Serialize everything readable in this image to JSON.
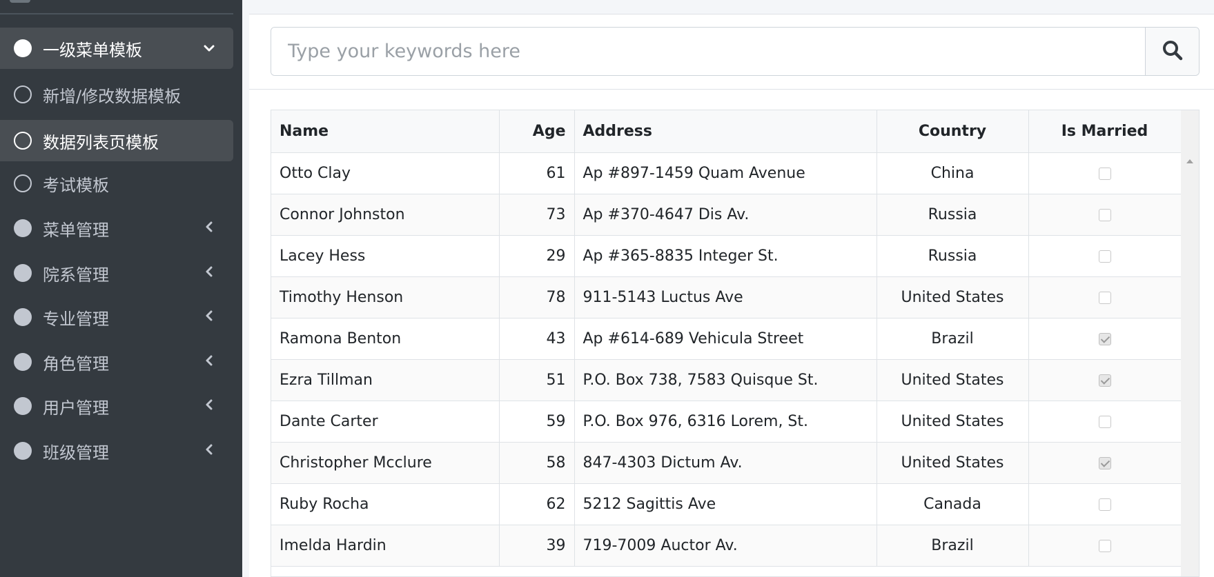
{
  "sidebar": {
    "items": [
      {
        "label": "一级菜单模板",
        "icon": "circle-filled-icon",
        "caret": "chevron-down-icon",
        "state": "active-parent"
      },
      {
        "label": "新增/修改数据模板",
        "icon": "circle-outline-icon",
        "caret": "",
        "state": "child"
      },
      {
        "label": "数据列表页模板",
        "icon": "circle-outline-icon",
        "caret": "",
        "state": "active-child"
      },
      {
        "label": "考试模板",
        "icon": "circle-outline-icon",
        "caret": "",
        "state": "child"
      },
      {
        "label": "菜单管理",
        "icon": "circle-filled-icon",
        "caret": "chevron-left-icon",
        "state": "parent"
      },
      {
        "label": "院系管理",
        "icon": "circle-filled-icon",
        "caret": "chevron-left-icon",
        "state": "parent"
      },
      {
        "label": "专业管理",
        "icon": "circle-filled-icon",
        "caret": "chevron-left-icon",
        "state": "parent"
      },
      {
        "label": "角色管理",
        "icon": "circle-filled-icon",
        "caret": "chevron-left-icon",
        "state": "parent"
      },
      {
        "label": "用户管理",
        "icon": "circle-filled-icon",
        "caret": "chevron-left-icon",
        "state": "parent"
      },
      {
        "label": "班级管理",
        "icon": "circle-filled-icon",
        "caret": "chevron-left-icon",
        "state": "parent"
      }
    ]
  },
  "search": {
    "placeholder": "Type your keywords here",
    "value": "",
    "button_icon": "search-icon"
  },
  "table": {
    "headers": {
      "name": "Name",
      "age": "Age",
      "address": "Address",
      "country": "Country",
      "married": "Is Married"
    },
    "rows": [
      {
        "name": "Otto Clay",
        "age": "61",
        "address": "Ap #897-1459 Quam Avenue",
        "country": "China",
        "married": false
      },
      {
        "name": "Connor Johnston",
        "age": "73",
        "address": "Ap #370-4647 Dis Av.",
        "country": "Russia",
        "married": false
      },
      {
        "name": "Lacey Hess",
        "age": "29",
        "address": "Ap #365-8835 Integer St.",
        "country": "Russia",
        "married": false
      },
      {
        "name": "Timothy Henson",
        "age": "78",
        "address": "911-5143 Luctus Ave",
        "country": "United States",
        "married": false
      },
      {
        "name": "Ramona Benton",
        "age": "43",
        "address": "Ap #614-689 Vehicula Street",
        "country": "Brazil",
        "married": true
      },
      {
        "name": "Ezra Tillman",
        "age": "51",
        "address": "P.O. Box 738, 7583 Quisque St.",
        "country": "United States",
        "married": true
      },
      {
        "name": "Dante Carter",
        "age": "59",
        "address": "P.O. Box 976, 6316 Lorem, St.",
        "country": "United States",
        "married": false
      },
      {
        "name": "Christopher Mcclure",
        "age": "58",
        "address": "847-4303 Dictum Av.",
        "country": "United States",
        "married": true
      },
      {
        "name": "Ruby Rocha",
        "age": "62",
        "address": "5212 Sagittis Ave",
        "country": "Canada",
        "married": false
      },
      {
        "name": "Imelda Hardin",
        "age": "39",
        "address": "719-7009 Auctor Av.",
        "country": "Brazil",
        "married": false
      }
    ]
  },
  "colors": {
    "sidebar_bg": "#343a40",
    "sidebar_active_bg": "#494e53",
    "sidebar_text": "#c2c7d0",
    "content_bg": "#ffffff",
    "table_header_bg": "#f8f9fa"
  }
}
